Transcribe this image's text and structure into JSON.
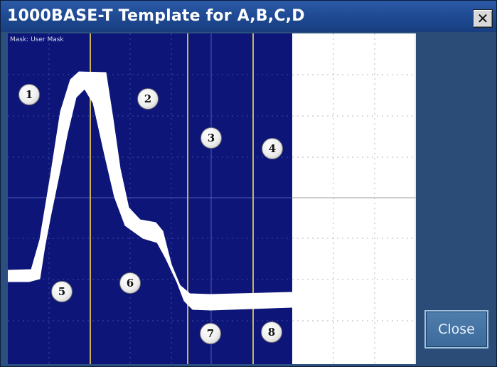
{
  "window": {
    "title": "1000BASE-T Template for A,B,C,D",
    "close_glyph": "✕"
  },
  "scope": {
    "mask_label": "Mask: User Mask",
    "regions": [
      "1",
      "2",
      "3",
      "4",
      "5",
      "6",
      "7",
      "8"
    ]
  },
  "buttons": {
    "close_label": "Close"
  },
  "colors": {
    "title_bar": "#1f4a93",
    "mask_fill": "#0d1579",
    "waveform": "#ffffff",
    "panel": "#2a4c76",
    "region_lines": "#c8b35a"
  }
}
